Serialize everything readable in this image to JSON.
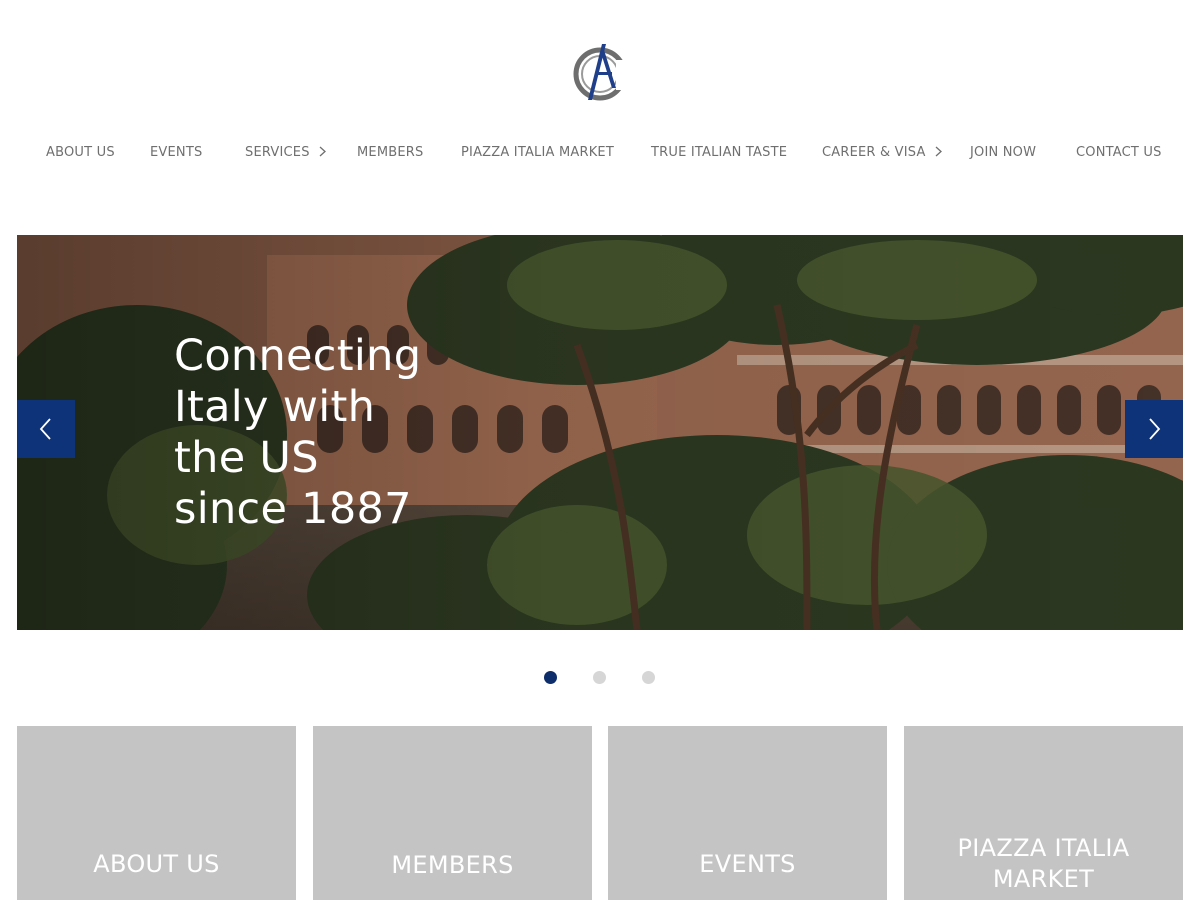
{
  "logo": {
    "alt": "AC 1887 logo",
    "colors": {
      "blue": "#1f3f8a",
      "gray": "#6e6e6e"
    }
  },
  "nav": {
    "items": [
      {
        "label": "ABOUT US"
      },
      {
        "label": "EVENTS"
      },
      {
        "label": "SERVICES",
        "has_submenu": true
      },
      {
        "label": "MEMBERS"
      },
      {
        "label": "PIAZZA ITALIA MARKET"
      },
      {
        "label": "TRUE ITALIAN TASTE"
      },
      {
        "label": "CAREER & VISA",
        "has_submenu": true
      },
      {
        "label": "JOIN NOW"
      },
      {
        "label": "CONTACT US"
      }
    ]
  },
  "hero": {
    "title_lines": [
      "Connecting",
      "Italy with",
      "the US",
      "since 1887"
    ],
    "prev_icon": "chevron-left-icon",
    "next_icon": "chevron-right-icon",
    "accent_color": "#0e3379"
  },
  "carousel": {
    "slide_count": 3,
    "active_index": 0
  },
  "cards": [
    {
      "label": "ABOUT US"
    },
    {
      "label": "MEMBERS"
    },
    {
      "label": "EVENTS"
    },
    {
      "label": "PIAZZA ITALIA MARKET",
      "lines": [
        "PIAZZA ITALIA",
        "MARKET"
      ]
    }
  ]
}
